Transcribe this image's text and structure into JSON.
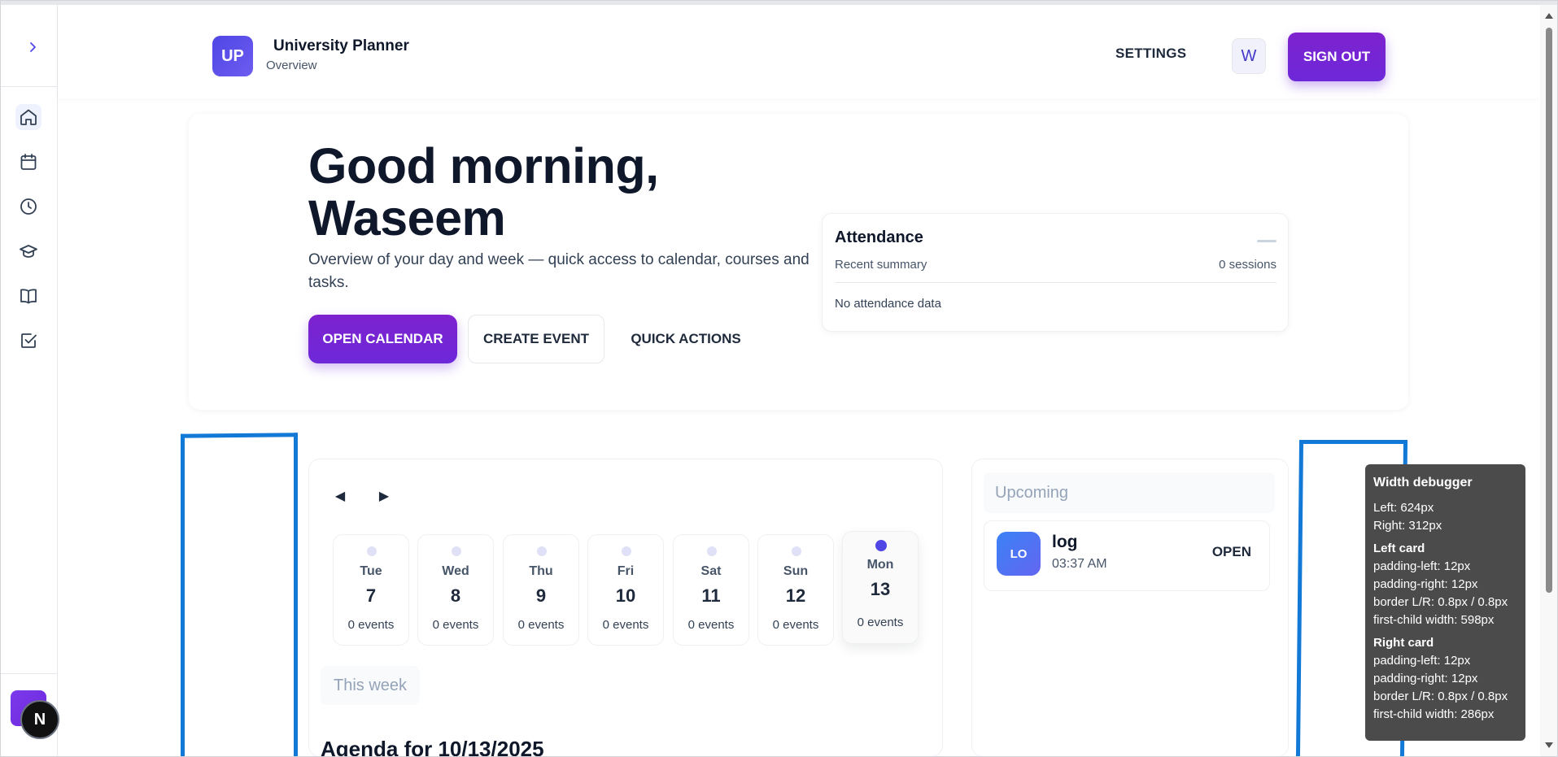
{
  "header": {
    "logo_text": "UP",
    "title": "University Planner",
    "subtitle": "Overview",
    "settings_label": "SETTINGS",
    "avatar_letter": "W",
    "signout_label": "SIGN OUT"
  },
  "sidebar": {
    "expand_icon": "chevron-right-icon",
    "items": [
      {
        "icon": "home-icon",
        "active": true
      },
      {
        "icon": "calendar-icon",
        "active": false
      },
      {
        "icon": "clock-icon",
        "active": false
      },
      {
        "icon": "graduation-cap-icon",
        "active": false
      },
      {
        "icon": "book-icon",
        "active": false
      },
      {
        "icon": "checkbox-icon",
        "active": false
      }
    ],
    "badge_letter": "N"
  },
  "hero": {
    "title": "Good morning, Waseem",
    "description": "Overview of your day and week — quick access to calendar, courses and tasks.",
    "open_calendar_label": "OPEN CALENDAR",
    "create_event_label": "CREATE EVENT",
    "quick_actions_label": "QUICK ACTIONS"
  },
  "attendance": {
    "title": "Attendance",
    "subtitle": "Recent summary",
    "count": "0 sessions",
    "empty": "No attendance data"
  },
  "calendar": {
    "prev_label": "◀",
    "next_label": "▶",
    "days": [
      {
        "name": "Tue",
        "num": "7",
        "events": "0 events",
        "active": false
      },
      {
        "name": "Wed",
        "num": "8",
        "events": "0 events",
        "active": false
      },
      {
        "name": "Thu",
        "num": "9",
        "events": "0 events",
        "active": false
      },
      {
        "name": "Fri",
        "num": "10",
        "events": "0 events",
        "active": false
      },
      {
        "name": "Sat",
        "num": "11",
        "events": "0 events",
        "active": false
      },
      {
        "name": "Sun",
        "num": "12",
        "events": "0 events",
        "active": false
      },
      {
        "name": "Mon",
        "num": "13",
        "events": "0 events",
        "active": true
      }
    ],
    "week_label": "This week",
    "agenda_title": "Agenda for 10/13/2025"
  },
  "upcoming": {
    "heading": "Upcoming",
    "items": [
      {
        "badge": "LO",
        "name": "log",
        "time": "03:37 AM",
        "action": "OPEN"
      }
    ]
  },
  "debugger": {
    "title": "Width debugger",
    "left": "Left: 624px",
    "right": "Right: 312px",
    "left_card_title": "Left card",
    "left_card_lines": [
      "padding-left: 12px",
      "padding-right: 12px",
      "border L/R: 0.8px / 0.8px",
      "first-child width: 598px"
    ],
    "right_card_title": "Right card",
    "right_card_lines": [
      "padding-left: 12px",
      "padding-right: 12px",
      "border L/R: 0.8px / 0.8px",
      "first-child width: 286px"
    ]
  },
  "colors": {
    "accent": "#6d28d9",
    "primary": "#4f46e5",
    "debug_blue": "#1379d6",
    "debug_panel": "#4b4b4b"
  }
}
